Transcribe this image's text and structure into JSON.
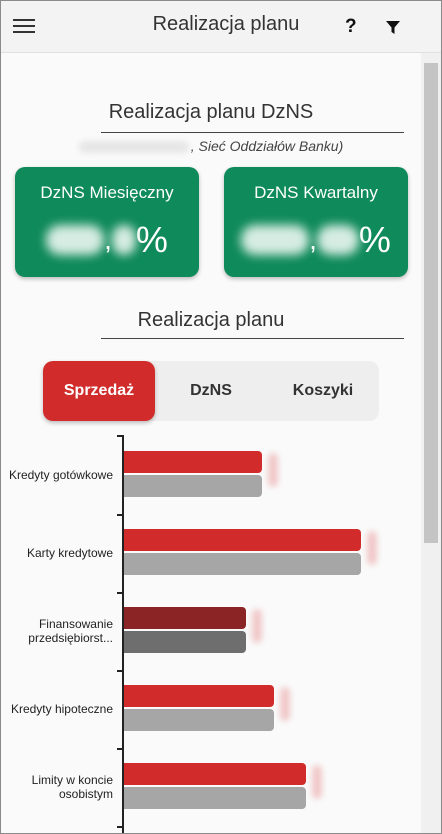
{
  "header": {
    "title": "Realizacja planu",
    "help_label": "?"
  },
  "colors": {
    "header_bg": "#f3f3f3",
    "kpi_green": "#0f8a5a",
    "tab_active": "#d12b2b",
    "bar_red": "#d12b2b",
    "bar_gray": "#a6a6a6",
    "bar_dark_red": "#8b2424",
    "bar_dark_gray": "#6e6e6e"
  },
  "dzns_section": {
    "title": "Realizacja planu DzNS",
    "subtitle": ", Sieć Oddziałów Banku)",
    "cards": [
      {
        "label": "DzNS Miesięczny",
        "comma": ",",
        "unit": "%"
      },
      {
        "label": "DzNS Kwartalny",
        "comma": ",",
        "unit": "%"
      }
    ]
  },
  "plan_section": {
    "title": "Realizacja planu",
    "tabs": [
      {
        "label": "Sprzedaż",
        "active": true
      },
      {
        "label": "DzNS",
        "active": false
      },
      {
        "label": "Koszyki",
        "active": false
      }
    ]
  },
  "chart_data": {
    "type": "bar",
    "orientation": "horizontal",
    "categories": [
      "Kredyty gotówkowe",
      "Karty kredytowe",
      "Finansowanie przedsiębiorst...",
      "Kredyty hipoteczne",
      "Limity w koncie osobistym"
    ],
    "series": [
      {
        "values": [
          138,
          237,
          122,
          150,
          182
        ]
      },
      {
        "values": [
          138,
          237,
          122,
          150,
          182
        ]
      }
    ],
    "highlighted_category": "Finansowanie przedsiębiorst...",
    "data_labels": "obscured"
  }
}
